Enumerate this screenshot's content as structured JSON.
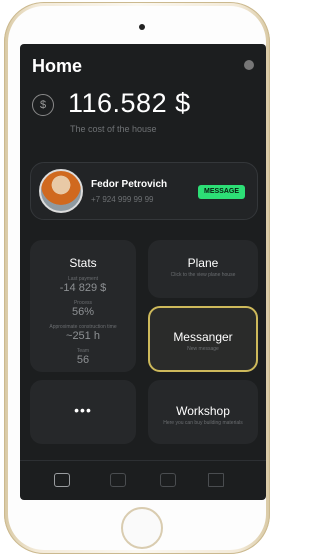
{
  "header": {
    "title": "Home"
  },
  "balance": {
    "amount": "116.582 $",
    "caption": "The cost of the house",
    "icon": "dollar-coin-icon"
  },
  "contact": {
    "name": "Fedor Petrovich",
    "phone": "+7 924 999 99 99",
    "badge": "MESSAGE"
  },
  "stats": {
    "title": "Stats",
    "items": [
      {
        "label": "Last payment",
        "value": "-14 829 $"
      },
      {
        "label": "Process",
        "value": "56%"
      },
      {
        "label": "Approximate construction time",
        "value": "~251 h"
      },
      {
        "label": "Team",
        "value": "56"
      }
    ]
  },
  "plane": {
    "title": "Plane",
    "subtitle": "Click to the view plane house"
  },
  "messanger": {
    "title": "Messanger",
    "subtitle": "New message"
  },
  "more": {
    "label": "•••"
  },
  "workshop": {
    "title": "Workshop",
    "subtitle": "Here you can buy building materials"
  },
  "tabs": [
    "home-icon",
    "inbox-icon",
    "wallet-icon",
    "chart-icon"
  ],
  "colors": {
    "background": "#1c1e1f",
    "accent_green": "#2ddf76",
    "accent_gold": "#cdb95b"
  }
}
